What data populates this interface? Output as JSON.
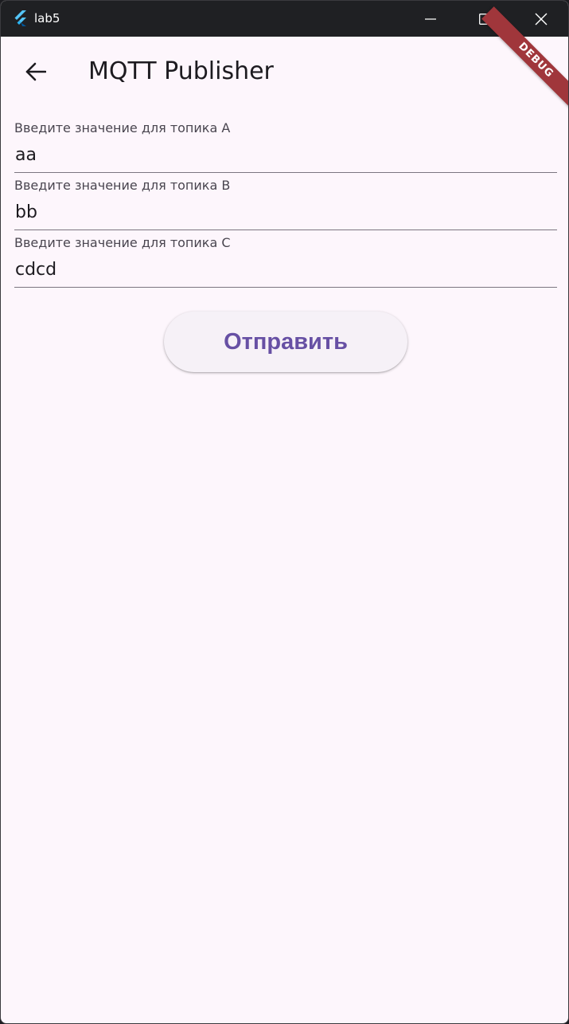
{
  "window": {
    "title": "lab5",
    "controls": [
      "minimize",
      "maximize",
      "close"
    ]
  },
  "appbar": {
    "title": "MQTT Publisher",
    "back_icon": "arrow-back-icon"
  },
  "debug_banner": {
    "label": "DEBUG"
  },
  "form": {
    "fields": [
      {
        "label": "Введите значение для топика A",
        "value": "aa"
      },
      {
        "label": "Введите значение для топика B",
        "value": "bb"
      },
      {
        "label": "Введите значение для топика C",
        "value": "cdcd"
      }
    ],
    "submit_label": "Отправить"
  },
  "colors": {
    "titlebar": "#1f2023",
    "background": "#fdf6fc",
    "accent": "#6750a4",
    "debug_banner": "#a0363b"
  }
}
